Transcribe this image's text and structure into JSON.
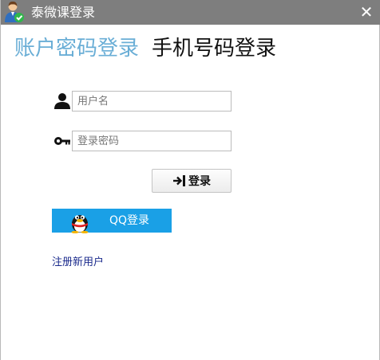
{
  "window": {
    "title": "泰微课登录",
    "app_icon": "user-check-icon",
    "close_icon": "close-icon",
    "close_glyph": "✕"
  },
  "tabs": [
    {
      "label": "账户密码登录",
      "active": true
    },
    {
      "label": "手机号码登录",
      "active": false
    }
  ],
  "form": {
    "username": {
      "value": "",
      "placeholder": "用户名",
      "icon": "user-icon"
    },
    "password": {
      "value": "",
      "placeholder": "登录密码",
      "icon": "key-icon"
    },
    "login_label": "登录",
    "login_icon": "enter-icon"
  },
  "qq_login": {
    "label": "QQ登录",
    "icon": "qq-penguin-icon"
  },
  "register_label": "注册新用户",
  "colors": {
    "titlebar": "#7e7e7e",
    "active_tab": "#6aaed6",
    "inactive_tab": "#111111",
    "qq_button": "#1aa0e6",
    "register_link": "#1a2a8c"
  }
}
